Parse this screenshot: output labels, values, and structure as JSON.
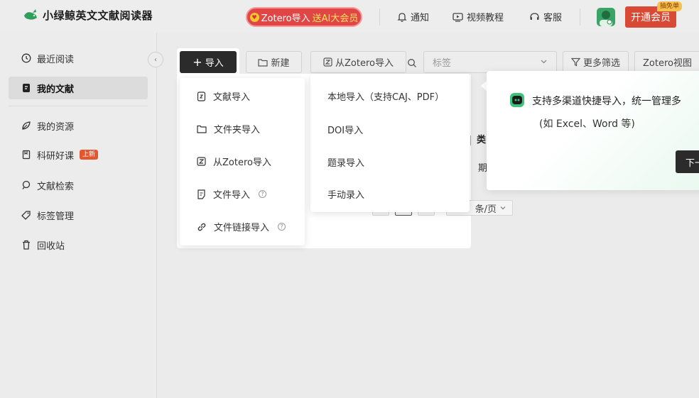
{
  "app": {
    "title": "小绿鲸英文文献阅读器"
  },
  "header": {
    "promo_prefix": "Zotero导入",
    "promo_highlight": "送AI大会员",
    "notify": "通知",
    "tutorial": "视频教程",
    "service": "客服",
    "vip_button": "开通会员",
    "vip_badge": "抽免单"
  },
  "sidebar": {
    "items": [
      {
        "label": "最近阅读",
        "icon": "clock-icon"
      },
      {
        "label": "我的文献",
        "icon": "document-icon",
        "active": true
      },
      {
        "label": "我的资源",
        "icon": "leaf-icon"
      },
      {
        "label": "科研好课",
        "icon": "book-icon",
        "badge": "上新"
      },
      {
        "label": "文献检索",
        "icon": "search-icon"
      },
      {
        "label": "标签管理",
        "icon": "tag-icon"
      },
      {
        "label": "回收站",
        "icon": "trash-icon"
      }
    ]
  },
  "toolbar": {
    "import": "导入",
    "new": "新建",
    "zotero_import": "从Zotero导入",
    "tag_placeholder": "标签",
    "more_filter": "更多筛选",
    "zotero_view": "Zotero视图"
  },
  "import_menu": {
    "items": [
      {
        "label": "文献导入",
        "icon": "doc-import-icon",
        "help": false
      },
      {
        "label": "文件夹导入",
        "icon": "folder-icon",
        "help": false
      },
      {
        "label": "从Zotero导入",
        "icon": "zotero-icon",
        "help": false
      },
      {
        "label": "文件导入",
        "icon": "file-icon",
        "help": true
      },
      {
        "label": "文件链接导入",
        "icon": "link-icon",
        "help": true
      }
    ]
  },
  "submenu": {
    "items": [
      "本地导入（支持CAJ、PDF）",
      "DOI导入",
      "题录导入",
      "手动录入"
    ]
  },
  "table_fragments": {
    "header_col": "类",
    "row_col": "期",
    "page_size_suffix": "条/页"
  },
  "tour": {
    "line1": "支持多渠道快捷导入，统一管理多",
    "line2": "(如 Excel、Word 等)",
    "next": "下一"
  },
  "colors": {
    "accent_dark": "#2b2b2b",
    "brand_green": "#3cc47c",
    "vip_red": "#d94a36"
  }
}
